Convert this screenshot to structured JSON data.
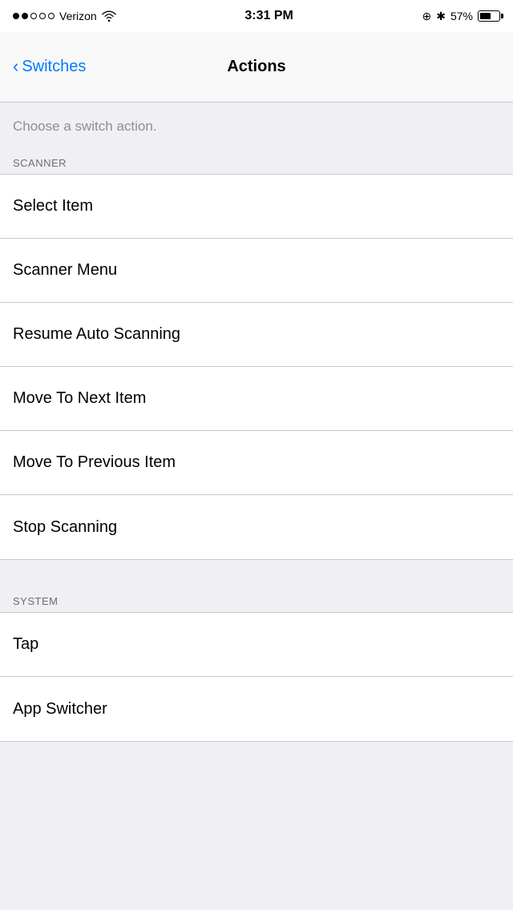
{
  "statusBar": {
    "carrier": "Verizon",
    "time": "3:31 PM",
    "battery_percent": "57%",
    "signal_dots": [
      true,
      true,
      false,
      false,
      false
    ]
  },
  "navBar": {
    "back_label": "Switches",
    "title": "Actions"
  },
  "description": "Choose a switch action.",
  "sections": [
    {
      "id": "scanner",
      "header": "SCANNER",
      "items": [
        {
          "id": "select-item",
          "label": "Select Item"
        },
        {
          "id": "scanner-menu",
          "label": "Scanner Menu"
        },
        {
          "id": "resume-auto-scanning",
          "label": "Resume Auto Scanning"
        },
        {
          "id": "move-to-next-item",
          "label": "Move To Next Item"
        },
        {
          "id": "move-to-previous-item",
          "label": "Move To Previous Item"
        },
        {
          "id": "stop-scanning",
          "label": "Stop Scanning"
        }
      ]
    },
    {
      "id": "system",
      "header": "SYSTEM",
      "items": [
        {
          "id": "tap",
          "label": "Tap"
        },
        {
          "id": "app-switcher",
          "label": "App Switcher"
        }
      ]
    }
  ]
}
